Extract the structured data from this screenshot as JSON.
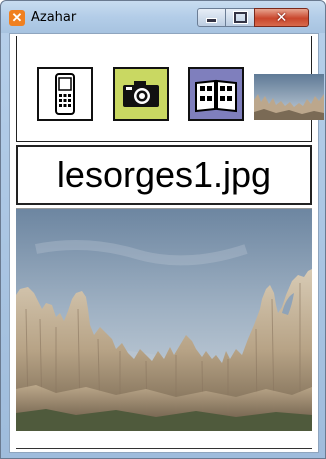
{
  "window": {
    "title": "Azahar",
    "app_icon_glyph": "✕",
    "controls": {
      "minimize": "minimize-icon",
      "maximize": "maximize-icon",
      "close": "close-icon",
      "close_glyph": "✕"
    }
  },
  "toolbar": {
    "items": [
      {
        "name": "phone-icon",
        "color": "#ffffff"
      },
      {
        "name": "camera-icon",
        "color": "#c9d862"
      },
      {
        "name": "album-icon",
        "color": "#7f7fbd"
      },
      {
        "name": "thumbnail-image"
      }
    ]
  },
  "viewer": {
    "filename": "lesorges1.jpg",
    "image_description": "photo"
  }
}
